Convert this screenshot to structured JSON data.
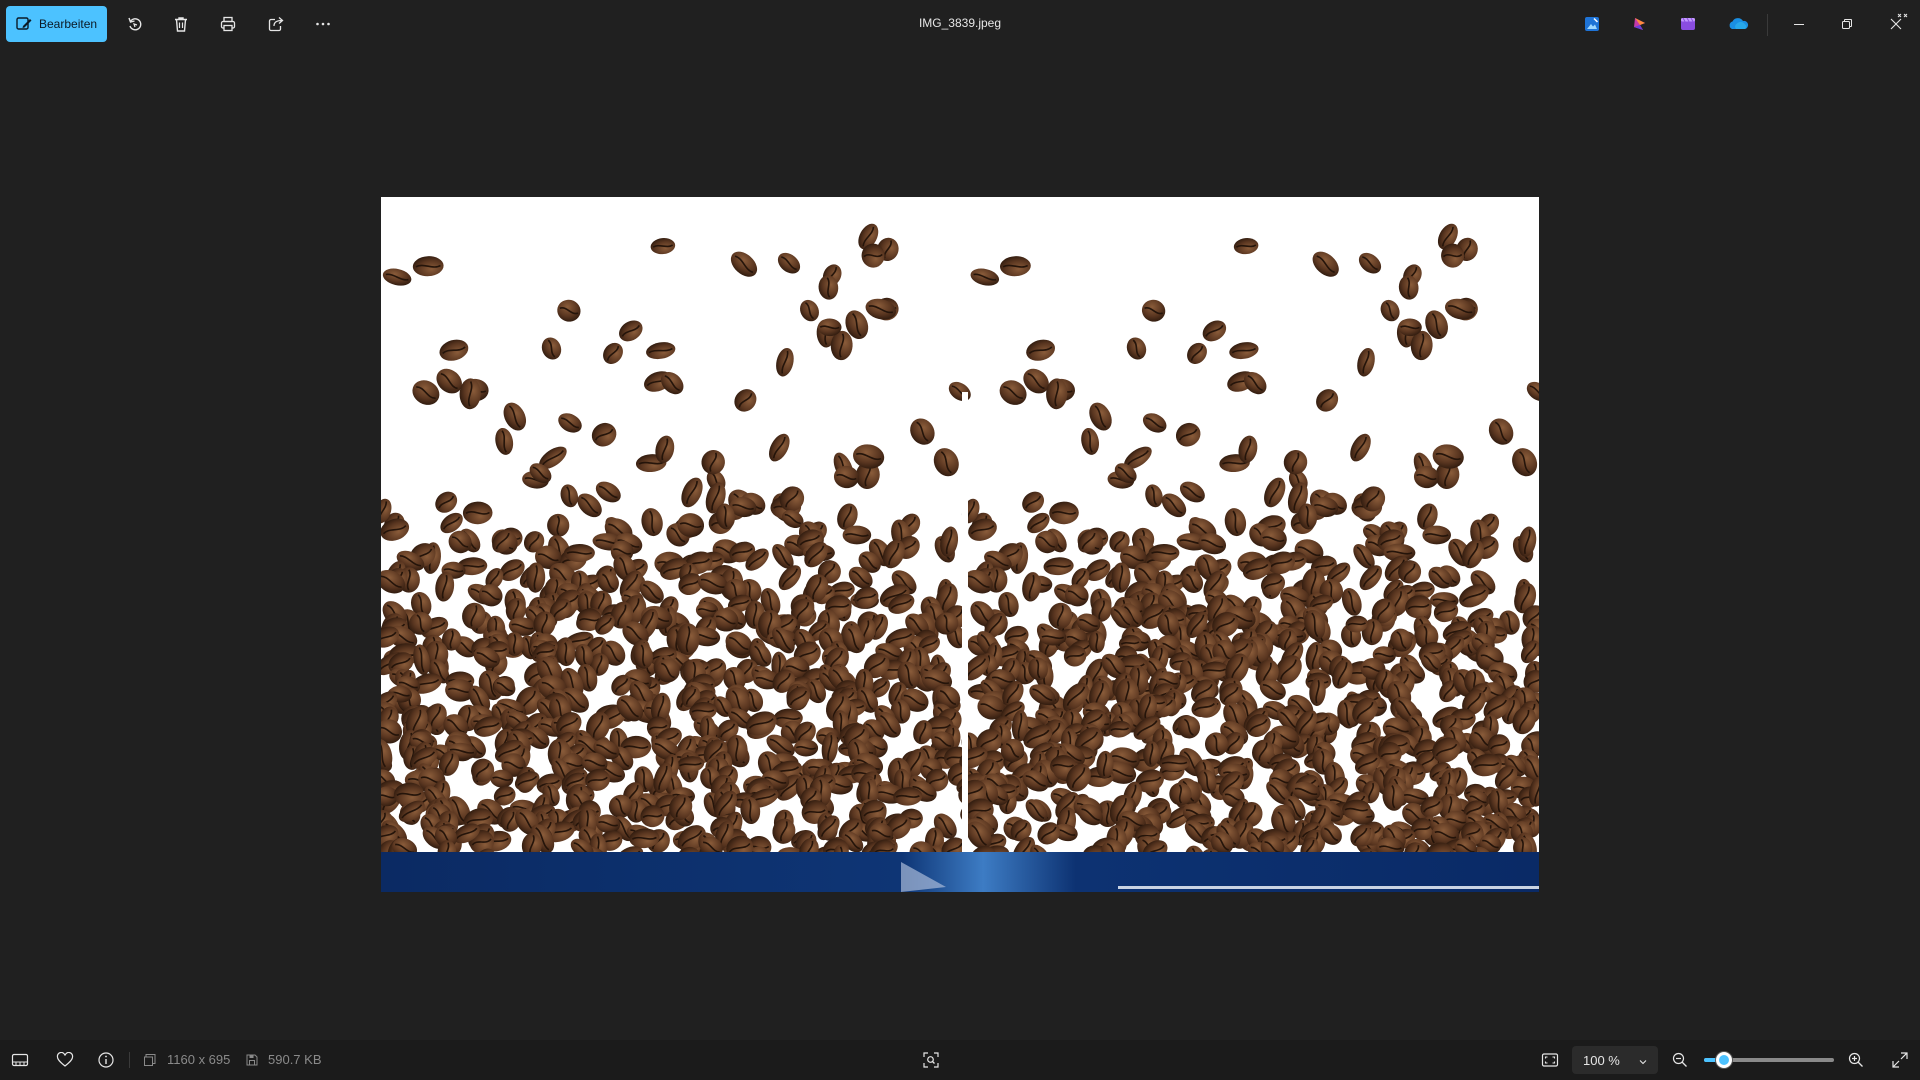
{
  "app": {
    "file_name": "IMG_3839.jpeg"
  },
  "toolbar": {
    "edit_label": "Bearbeiten",
    "icons": [
      "edit-icon",
      "rotate-icon",
      "trash-icon",
      "print-icon",
      "share-icon",
      "more-icon"
    ]
  },
  "title_actions": {
    "icons": [
      "image-creator-icon",
      "copilot-icon",
      "clipchamp-icon",
      "onedrive-icon",
      "minimize-icon",
      "restore-icon",
      "close-icon"
    ]
  },
  "status": {
    "dimensions": "1160 x 695",
    "file_size": "590.7 KB",
    "zoom_label": "100 %",
    "zoom_fraction": 0.15
  },
  "colors": {
    "accent": "#4cc2ff",
    "background": "#202020",
    "statusbar": "#1b1b1b"
  }
}
